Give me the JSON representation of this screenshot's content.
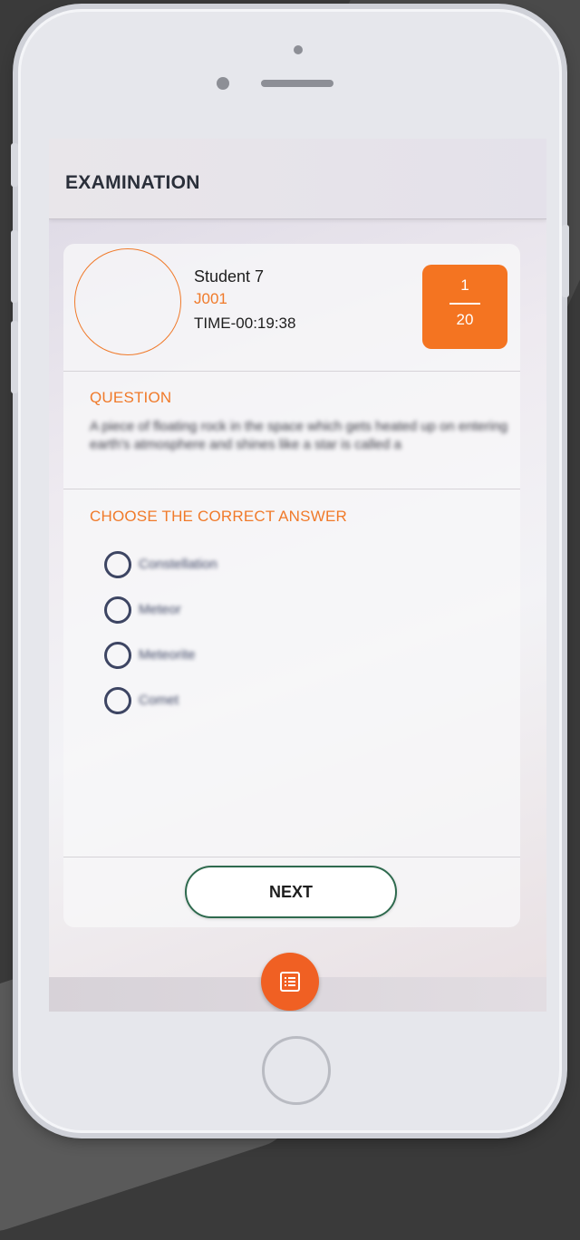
{
  "app": {
    "title": "EXAMINATION"
  },
  "student": {
    "name": "Student 7",
    "id": "J001",
    "time_prefix": "TIME-",
    "time_value": "00:19:38"
  },
  "question_counter": {
    "current": "1",
    "total": "20"
  },
  "question": {
    "section_label": "QUESTION",
    "text": "A piece of floating rock in the space which gets heated up on entering earth's atmosphere and shines like a star is called a"
  },
  "answers": {
    "section_label": "CHOOSE THE CORRECT ANSWER",
    "options": [
      {
        "label": "Constellation",
        "selected": false
      },
      {
        "label": "Meteor",
        "selected": false
      },
      {
        "label": "Meteorite",
        "selected": false
      },
      {
        "label": "Comet",
        "selected": false
      }
    ]
  },
  "actions": {
    "next_label": "NEXT"
  },
  "icons": {
    "fab": "question-list-icon",
    "avatar": "avatar-placeholder"
  },
  "colors": {
    "accent": "#f47421",
    "fab": "#f06023",
    "radio": "#3d4563",
    "next_border": "#2e6a4e"
  }
}
